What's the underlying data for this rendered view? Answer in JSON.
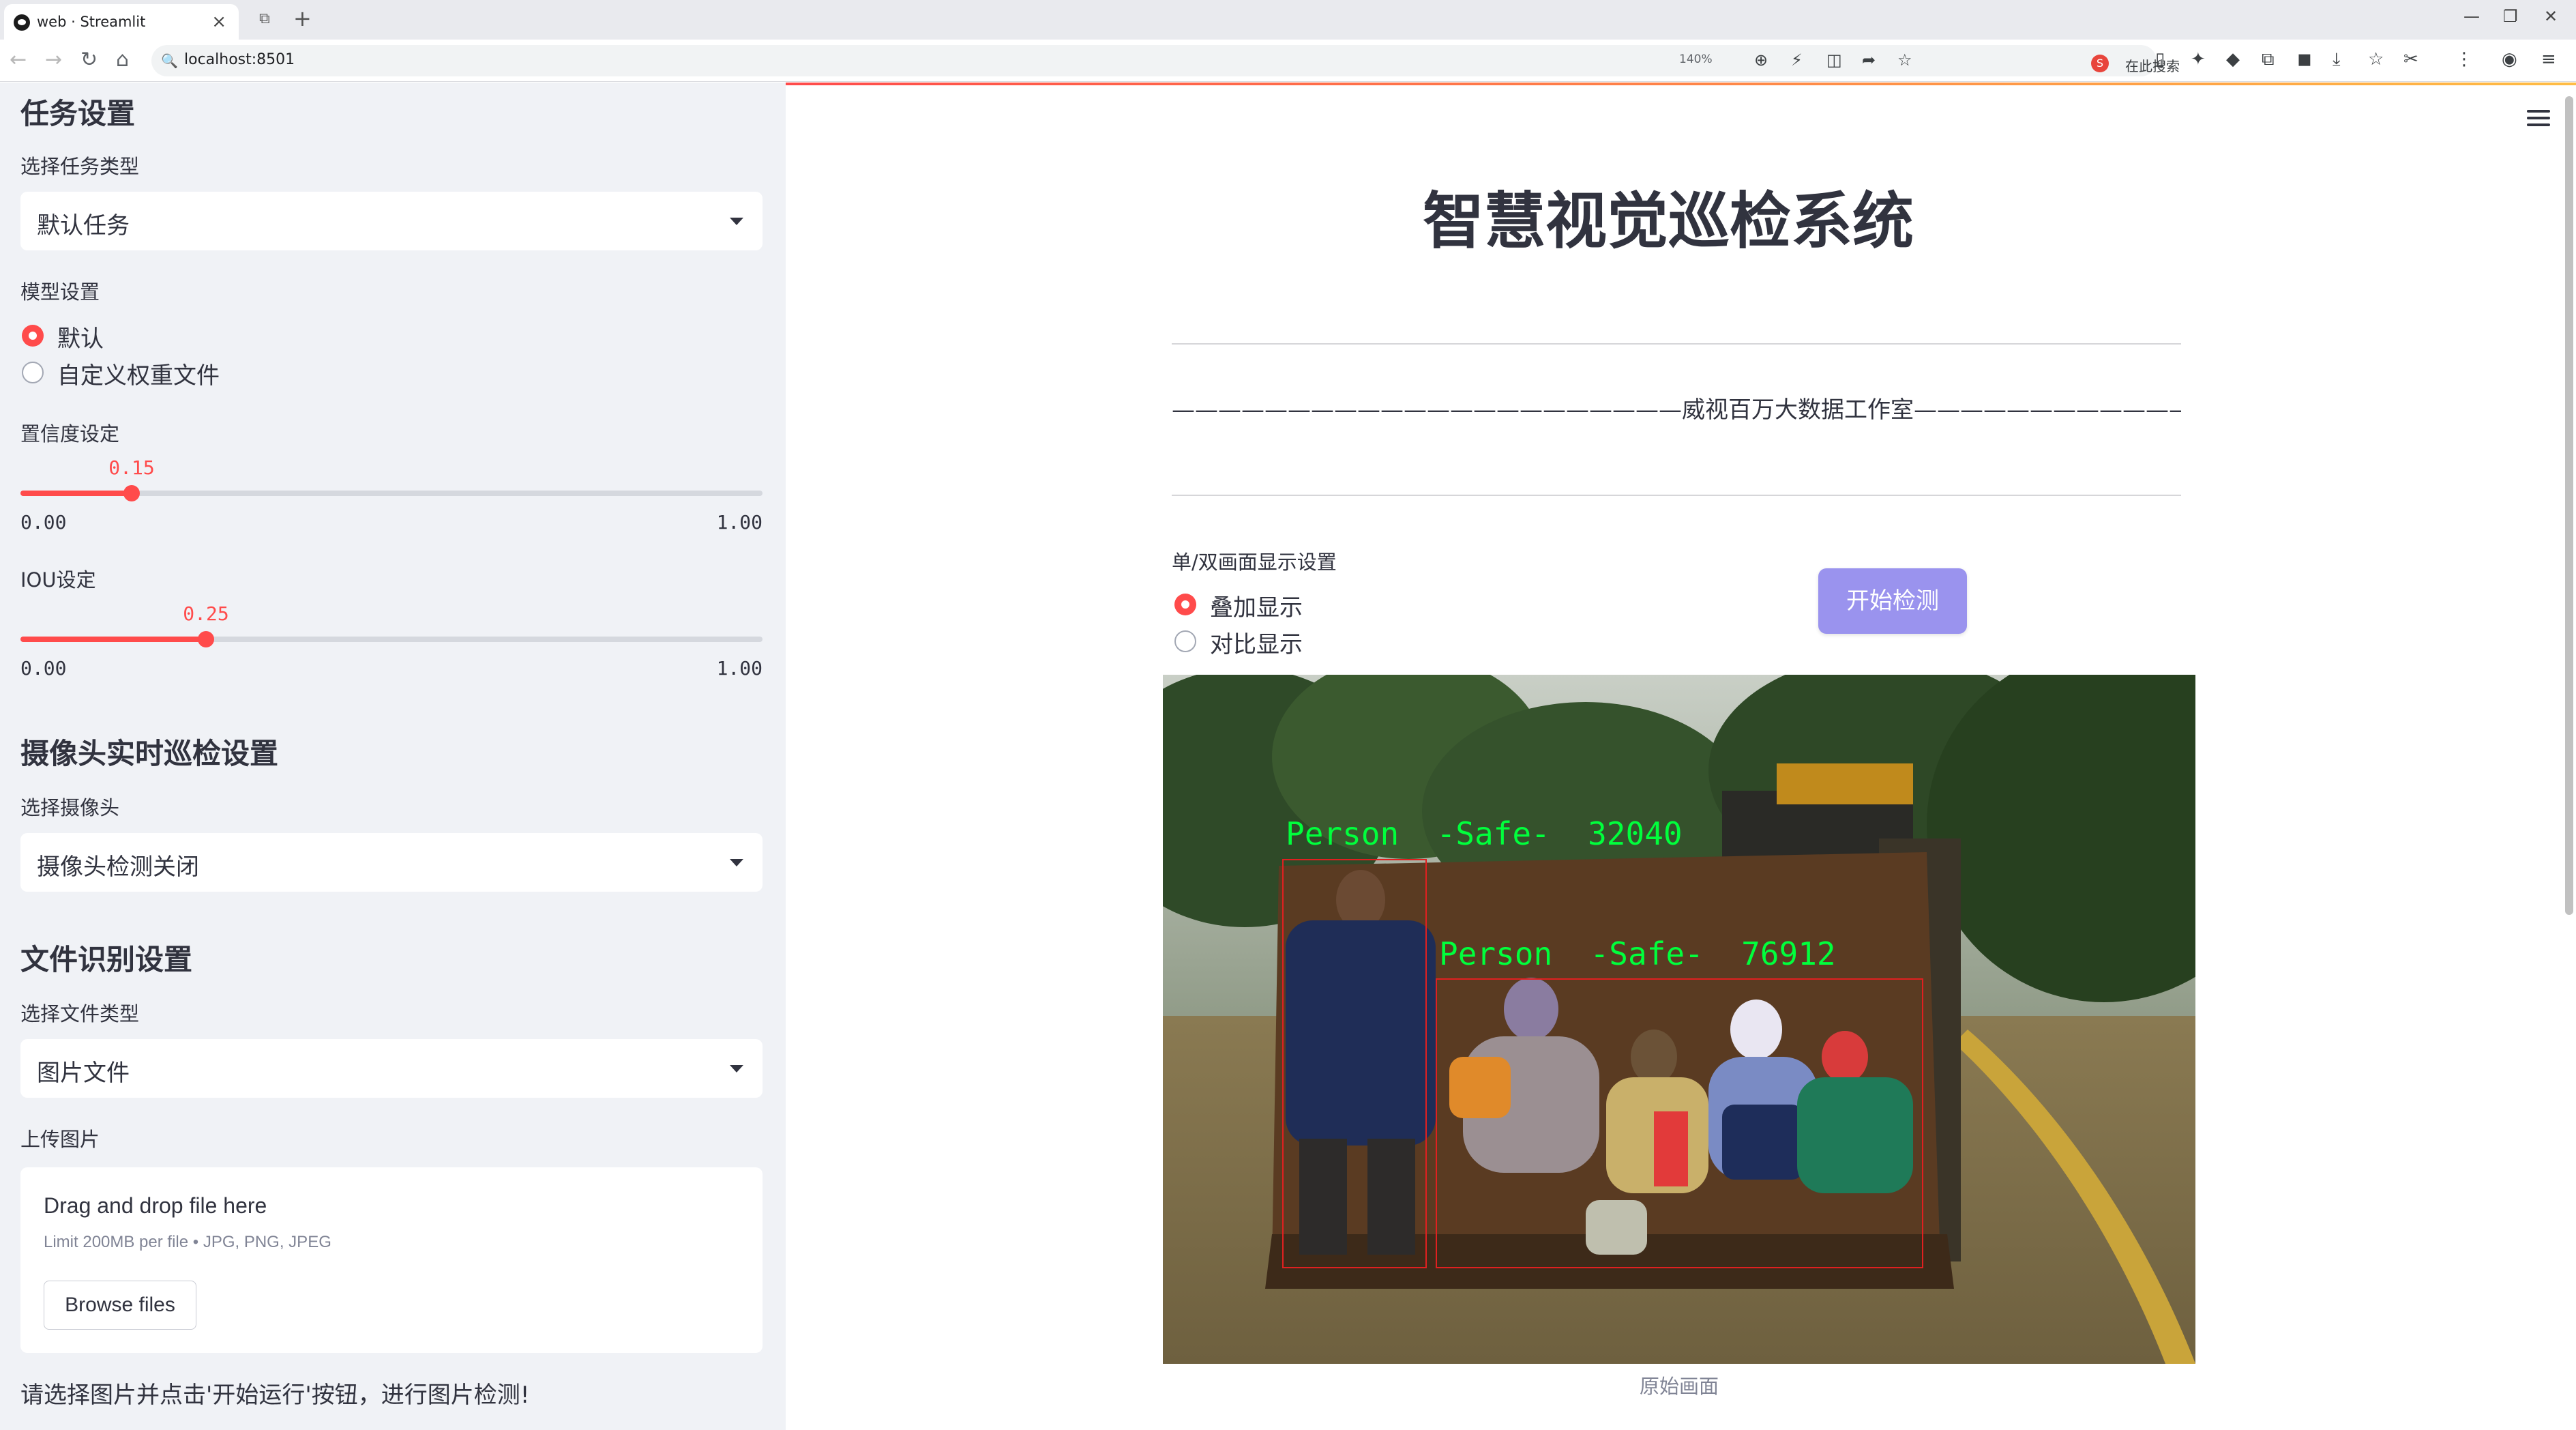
{
  "browser": {
    "tab_title": "web · Streamlit",
    "url": "localhost:8501",
    "zoom": "140%",
    "search_placeholder": "在此搜索"
  },
  "sidebar": {
    "task_header": "任务设置",
    "task_type_label": "选择任务类型",
    "task_type_value": "默认任务",
    "model_label": "模型设置",
    "model_options": [
      "默认",
      "自定义权重文件"
    ],
    "model_selected": "默认",
    "conf_label": "置信度设定",
    "conf_value": "0.15",
    "conf_min": "0.00",
    "conf_max": "1.00",
    "iou_label": "IOU设定",
    "iou_value": "0.25",
    "iou_min": "0.00",
    "iou_max": "1.00",
    "camera_header": "摄像头实时巡检设置",
    "camera_label": "选择摄像头",
    "camera_value": "摄像头检测关闭",
    "file_header": "文件识别设置",
    "file_type_label": "选择文件类型",
    "file_type_value": "图片文件",
    "upload_label": "上传图片",
    "upload_title": "Drag and drop file here",
    "upload_limit": "Limit 200MB per file • JPG, PNG, JPEG",
    "browse_label": "Browse files",
    "hint": "请选择图片并点击'开始运行'按钮，进行图片检测!"
  },
  "main": {
    "title": "智慧视觉巡检系统",
    "studio": "——————————————————————威视百万大数据工作室———————————————————————",
    "display_label": "单/双画面显示设置",
    "display_options": [
      "叠加显示",
      "对比显示"
    ],
    "display_selected": "叠加显示",
    "start_button": "开始检测",
    "image_caption": "原始画面",
    "detections": [
      {
        "label": "Person  -Safe-  32040",
        "color": "#00ff3c"
      },
      {
        "label": "Person  -Safe-  76912",
        "color": "#00ff3c"
      }
    ],
    "box_color": "#e02020"
  },
  "colors": {
    "accent": "#ff4b4b",
    "button": "#9a93ee",
    "sidebar_bg": "#f0f2f6"
  }
}
